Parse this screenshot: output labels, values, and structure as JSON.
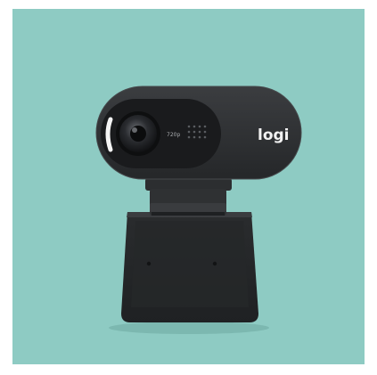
{
  "image": {
    "subject": "Logitech webcam",
    "background_color": "#8ecbc3",
    "body_color": "#2f3133",
    "resolution_label": "720p",
    "brand_logo": "logi"
  }
}
